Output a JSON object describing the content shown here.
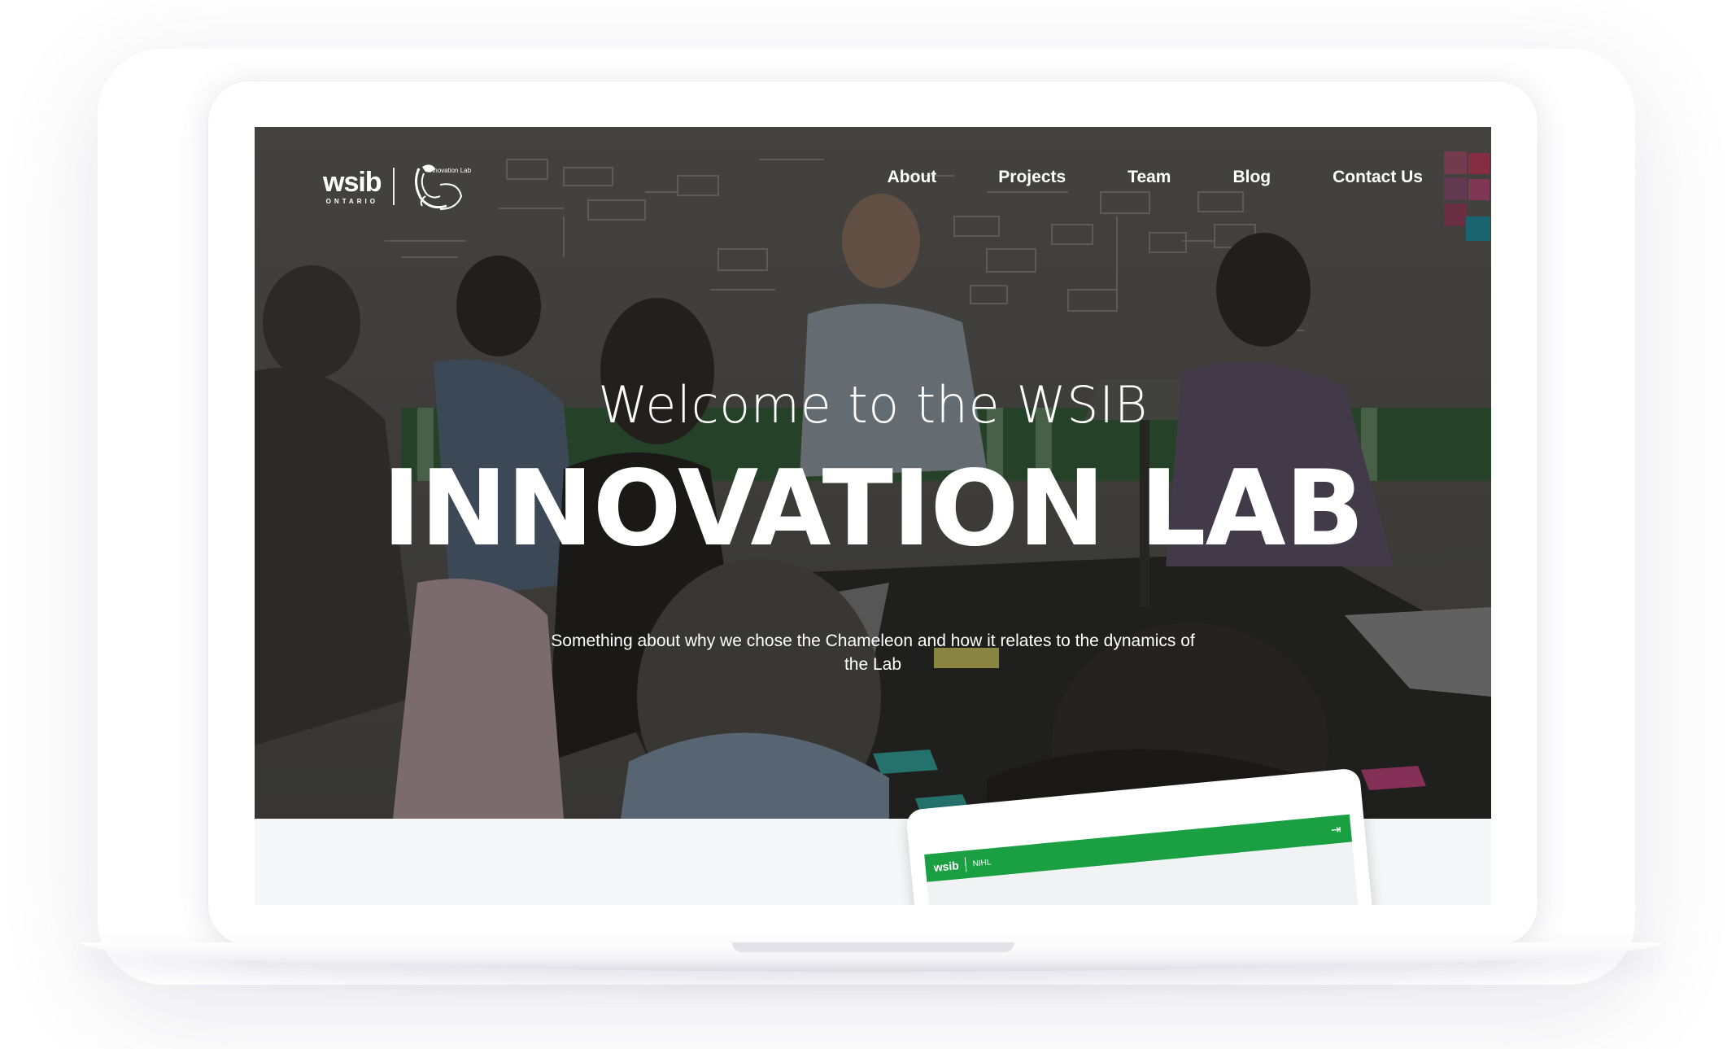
{
  "brand": {
    "wsib": "wsib",
    "ontario": "ONTARIO",
    "lab_name": "Innovation Lab"
  },
  "nav": {
    "items": [
      {
        "label": "About"
      },
      {
        "label": "Projects"
      },
      {
        "label": "Team"
      },
      {
        "label": "Blog"
      },
      {
        "label": "Contact Us"
      }
    ]
  },
  "hero": {
    "welcome": "Welcome to the WSIB",
    "headline": "INNOVATION LAB",
    "tagline": "Something about why we chose the Chameleon and how it relates to the dynamics of the Lab"
  },
  "preview": {
    "wsib": "wsib",
    "nihl": "NIHL",
    "login_icon": "login-icon",
    "accent_color": "#1aa043"
  },
  "colors": {
    "accent_green": "#1aa043",
    "overlay": "#1e1e1e"
  }
}
